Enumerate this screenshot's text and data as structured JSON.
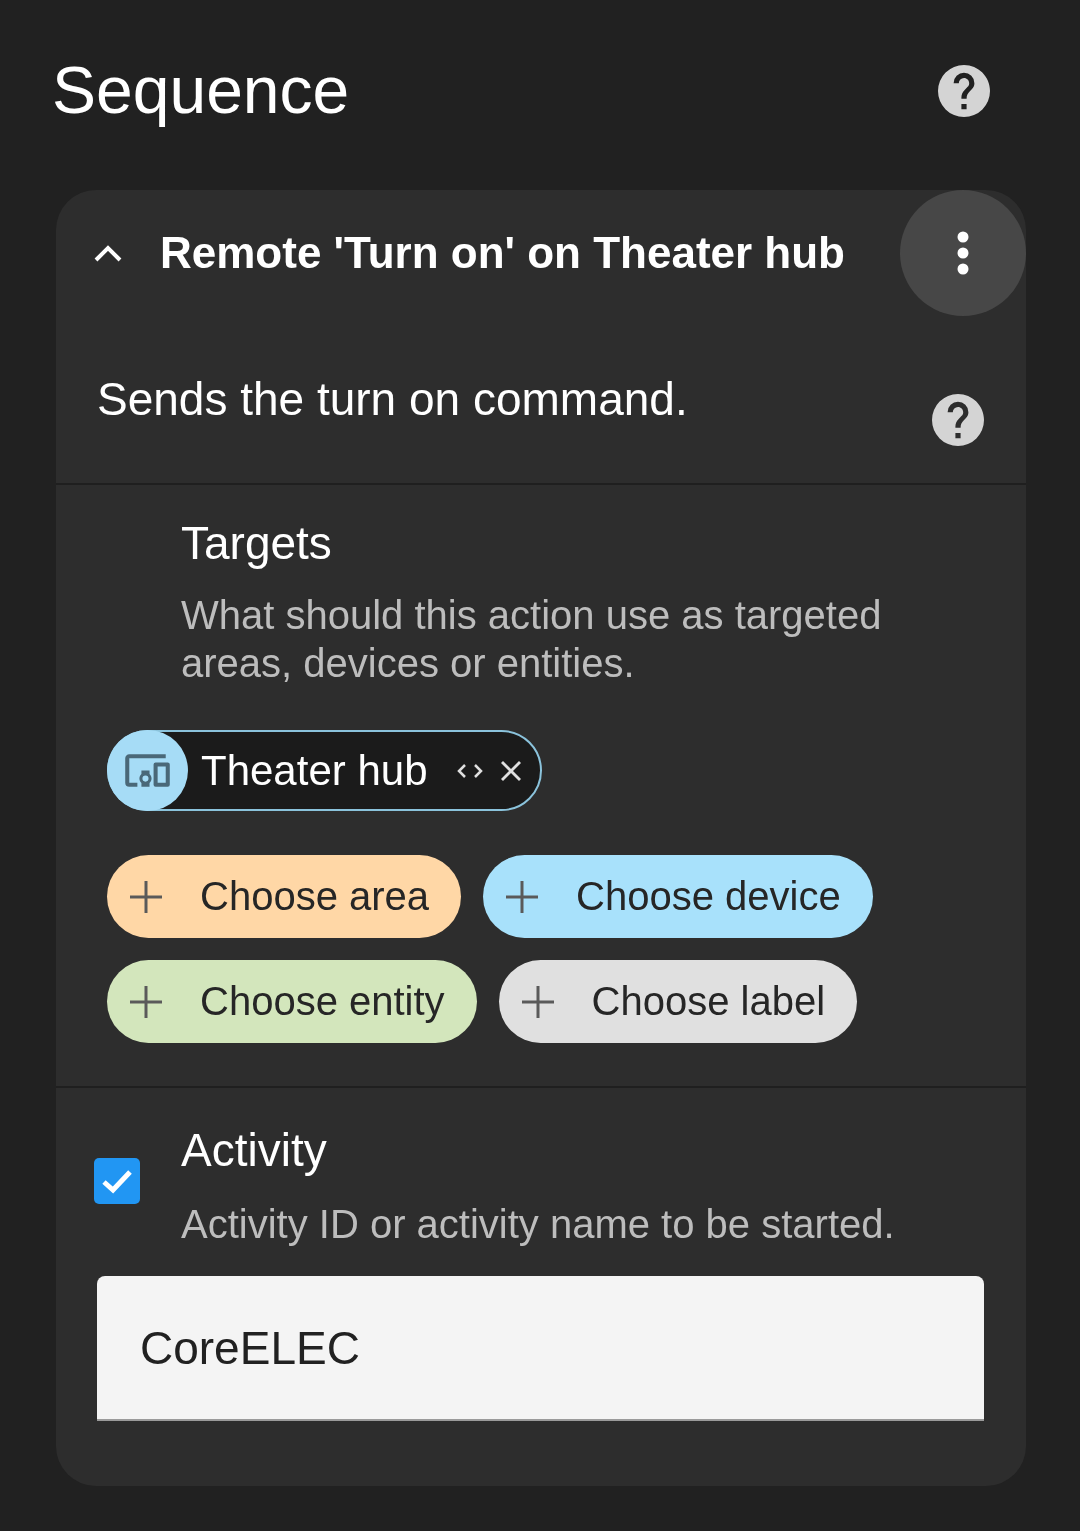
{
  "page": {
    "title": "Sequence"
  },
  "action": {
    "title": "Remote 'Turn on' on Theater hub",
    "expanded": true,
    "description": "Sends the turn on command.",
    "targets": {
      "name": "Targets",
      "description": "What should this action use as targeted areas, devices or entities.",
      "chips": [
        {
          "kind": "device",
          "label": "Theater hub"
        }
      ],
      "add_buttons": [
        {
          "label": "Choose area",
          "color": "#ffd7a6"
        },
        {
          "label": "Choose device",
          "color": "#a8e1fb"
        },
        {
          "label": "Choose entity",
          "color": "#d3e6bc"
        },
        {
          "label": "Choose label",
          "color": "#e0e0e0"
        }
      ]
    },
    "activity": {
      "name": "Activity",
      "checked": true,
      "description": "Activity ID or activity name to be started.",
      "value": "CoreELEC"
    }
  }
}
